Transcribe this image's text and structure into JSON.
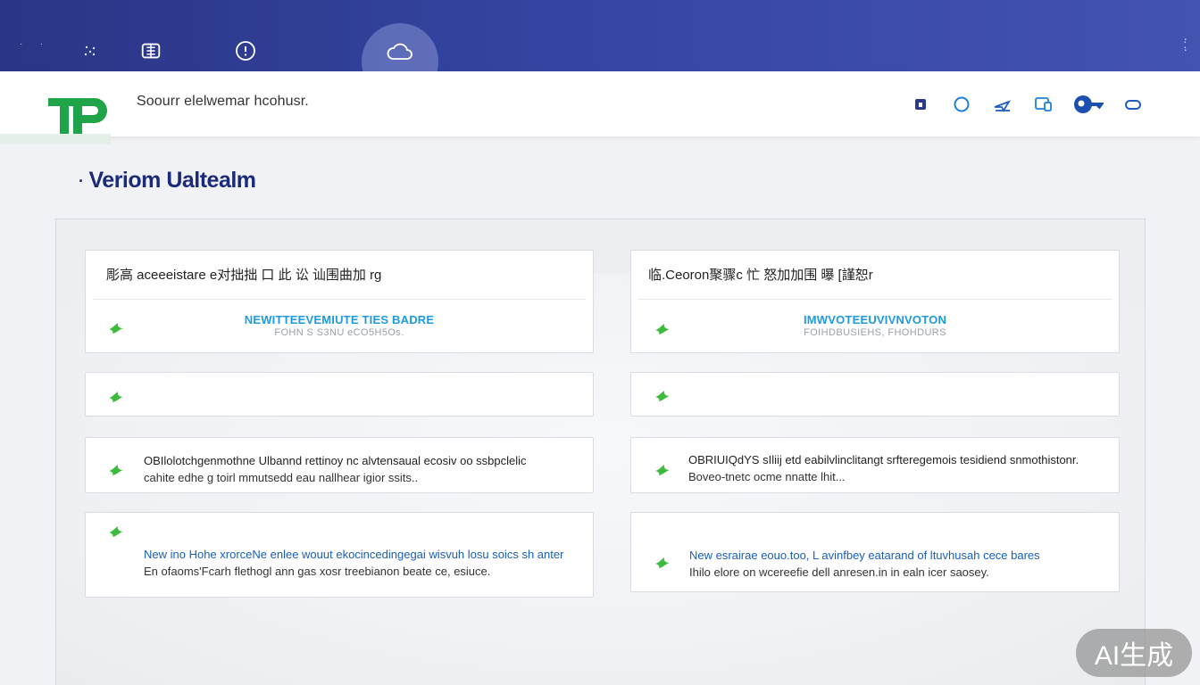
{
  "topbar": {
    "icons": [
      "dots-icon",
      "sparkle-icon",
      "chip-icon",
      "info-icon",
      "cloud-icon",
      "more-vertical-icon"
    ]
  },
  "header": {
    "title": "Soourr elelwemar hcohusr.",
    "icons": [
      "lock-icon",
      "circle-icon",
      "send-icon",
      "devices-icon",
      "key-icon",
      "cloud-outline-icon"
    ]
  },
  "page": {
    "title": "Veriom Ualtealm"
  },
  "cards": {
    "left_top": {
      "heading": "彫高 aceeeistare e对拙拙 口 此 讼 讪围曲加 rg",
      "link": "NEWITTEEVEMIUTE TIES BADRE",
      "sub": "FOHN S S3NU eCO5H5Os."
    },
    "right_top": {
      "heading": "临.Ceoron聚骤c 忙 怒加加围 曝 [謹恕r",
      "link": "IMWVOTEEUVIVNVOTON",
      "sub": "FOIHDBUSIEHS, FHOHDURS"
    },
    "left_third": {
      "line1": "OBIlolotchgenmothne Ulbannd rettinoy nc alvtensaual ecosiv oo ssbpclelic",
      "line2": "cahite edhe g toirl mmutsedd eau nallhear igior ssits.."
    },
    "right_third": {
      "line1": "OBRIUIQdYS sIliij etd eabilvlinclitangt srfteregemois tesidiend snmothistonr.",
      "line2": "Boveo-tnetc ocme nnatte lhit..."
    },
    "left_fourth": {
      "line1": "New ino Hohe xrorceNe enlee wouut ekocincedingegai wisvuh losu soics sh anter",
      "line2": "En ofaoms'Fcarh flethogl ann gas xosr treebianon beate ce, esiuce."
    },
    "right_fourth": {
      "line1": "New esrairae eouo.too, L avinfbey eatarand of ltuvhusah cece bares",
      "line2": "Ihilo elore on wcereefie dell anresen.in in ealn icer saosey."
    }
  },
  "watermark": "AI生成",
  "colors": {
    "topbar": "#2f3d95",
    "title": "#1c2a7a",
    "link": "#1e9be0",
    "leaf": "#3dbb3d",
    "logo": "#1fa44a"
  }
}
